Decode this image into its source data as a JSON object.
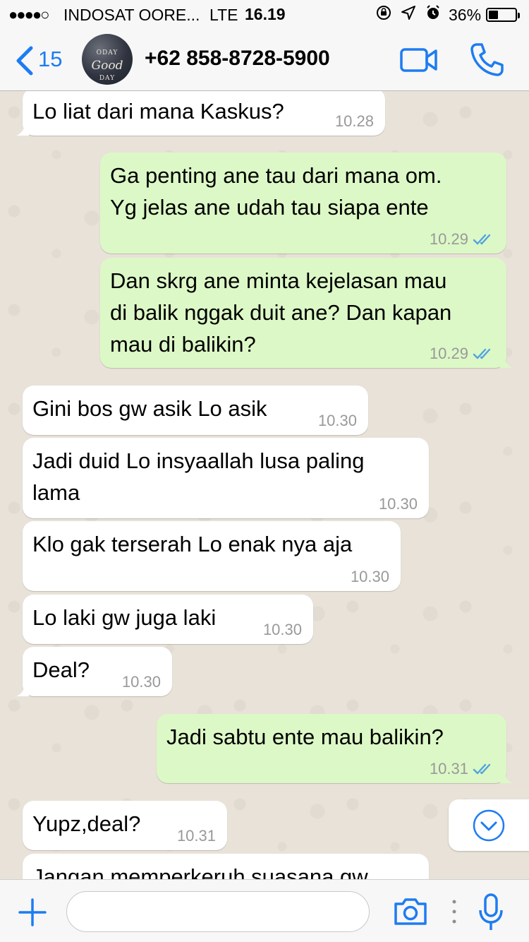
{
  "status_bar": {
    "signal": "●●●●○",
    "carrier": "INDOSAT OORE...",
    "network": "LTE",
    "time": "16.19",
    "icons": [
      "orientation-lock-icon",
      "location-arrow-icon",
      "alarm-icon"
    ],
    "battery_percent": "36%",
    "battery_level": 0.36
  },
  "header": {
    "back_count": "15",
    "avatar_text_top": "ODAY",
    "avatar_text_mid": "Good",
    "avatar_text_bottom": "DAY",
    "contact_name": "+62 858-8728-5900",
    "accent_color": "#1d7cf2"
  },
  "messages": [
    {
      "direction": "incoming",
      "text": "Lo liat dari mana Kaskus?",
      "time": "10.28",
      "tail": true
    },
    {
      "direction": "outgoing",
      "text": "Ga penting ane tau dari mana om.\nYg jelas ane udah tau siapa ente",
      "time": "10.29",
      "read": true,
      "tail": false
    },
    {
      "direction": "outgoing",
      "text": "Dan skrg ane minta kejelasan mau\ndi balik nggak duit ane? Dan kapan\nmau di balikin?",
      "time": "10.29",
      "read": true,
      "tail": true
    },
    {
      "direction": "incoming",
      "text": "Gini bos gw asik Lo asik",
      "time": "10.30",
      "tail": false
    },
    {
      "direction": "incoming",
      "text": "Jadi duid Lo insyaallah lusa paling\nlama",
      "time": "10.30",
      "tail": false
    },
    {
      "direction": "incoming",
      "text": "Klo gak terserah Lo enak nya aja",
      "time": "10.30",
      "tail": false
    },
    {
      "direction": "incoming",
      "text": "Lo laki gw juga laki",
      "time": "10.30",
      "tail": false
    },
    {
      "direction": "incoming",
      "text": "Deal?",
      "time": "10.30",
      "tail": true
    },
    {
      "direction": "outgoing",
      "text": "Jadi sabtu ente mau balikin?",
      "time": "10.31",
      "read": true,
      "tail": true
    },
    {
      "direction": "incoming",
      "text": "Yupz,deal?",
      "time": "10.31",
      "tail": false
    },
    {
      "direction": "incoming",
      "text": "Jangan memperkeruh suasana gw",
      "time": "",
      "tail": false
    }
  ],
  "input_bar": {
    "placeholder": "",
    "value": ""
  },
  "colors": {
    "incoming_bubble": "#ffffff",
    "outgoing_bubble": "#dcf8c6",
    "read_ticks": "#4fa3e0",
    "timestamp": "#999999"
  }
}
